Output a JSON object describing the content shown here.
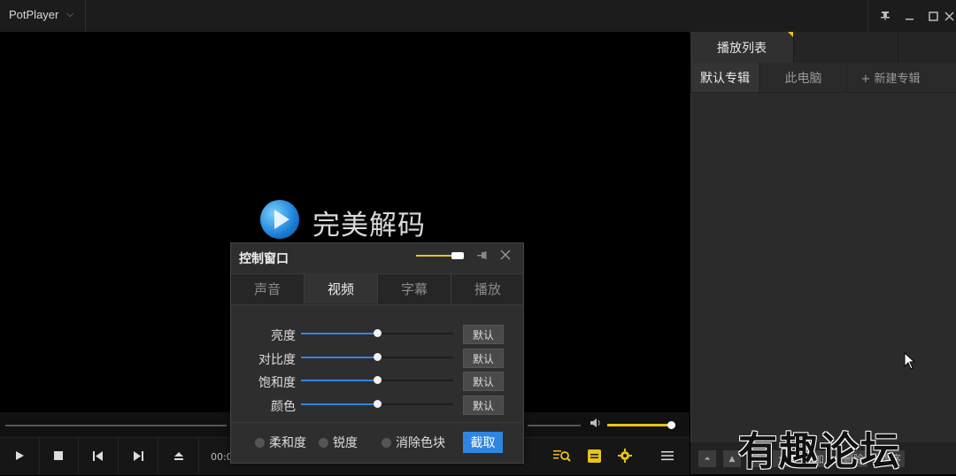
{
  "app": {
    "title": "PotPlayer"
  },
  "video": {
    "logo_text": "完美解码",
    "time": "00:0"
  },
  "playlist": {
    "tab": "播放列表",
    "albums": [
      "默认专辑",
      "此电脑",
      "+ 新建专辑"
    ],
    "bottom_buttons": [
      "添加",
      "删除",
      "排序"
    ]
  },
  "control_window": {
    "title": "控制窗口",
    "tabs": [
      "声音",
      "视频",
      "字幕",
      "播放"
    ],
    "active_tab": "视频",
    "sliders": [
      {
        "label": "亮度",
        "value": 0.5,
        "button": "默认"
      },
      {
        "label": "对比度",
        "value": 0.5,
        "button": "默认"
      },
      {
        "label": "饱和度",
        "value": 0.5,
        "button": "默认"
      },
      {
        "label": "颜色",
        "value": 0.5,
        "button": "默认"
      }
    ],
    "options": [
      "柔和度",
      "锐度",
      "消除色块"
    ],
    "capture_label": "截取"
  },
  "volume": {
    "level": 0.98
  },
  "watermark": "有趣论坛",
  "colors": {
    "accent_yellow": "#e8c31a",
    "accent_blue": "#2f86e0"
  }
}
